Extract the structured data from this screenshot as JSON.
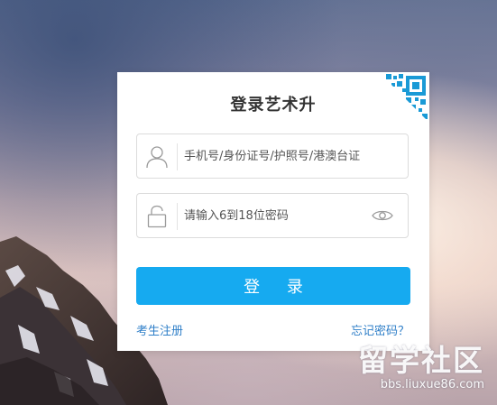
{
  "login": {
    "title": "登录艺术升",
    "account_placeholder": "手机号/身份证号/护照号/港澳台证",
    "password_placeholder": "请输入6到18位密码",
    "login_label": "登 录",
    "register_label": "考生注册",
    "forgot_label": "忘记密码？"
  },
  "watermark": {
    "title": "留学社区",
    "url": "bbs.liuxue86.com"
  },
  "icons": {
    "account": "user-icon",
    "password": "lock-icon",
    "toggle": "eye-icon",
    "qr": "qr-code-icon"
  },
  "colors": {
    "primary": "#16aaf0",
    "link": "#2f7fc8",
    "qr": "#1a9ad6"
  }
}
